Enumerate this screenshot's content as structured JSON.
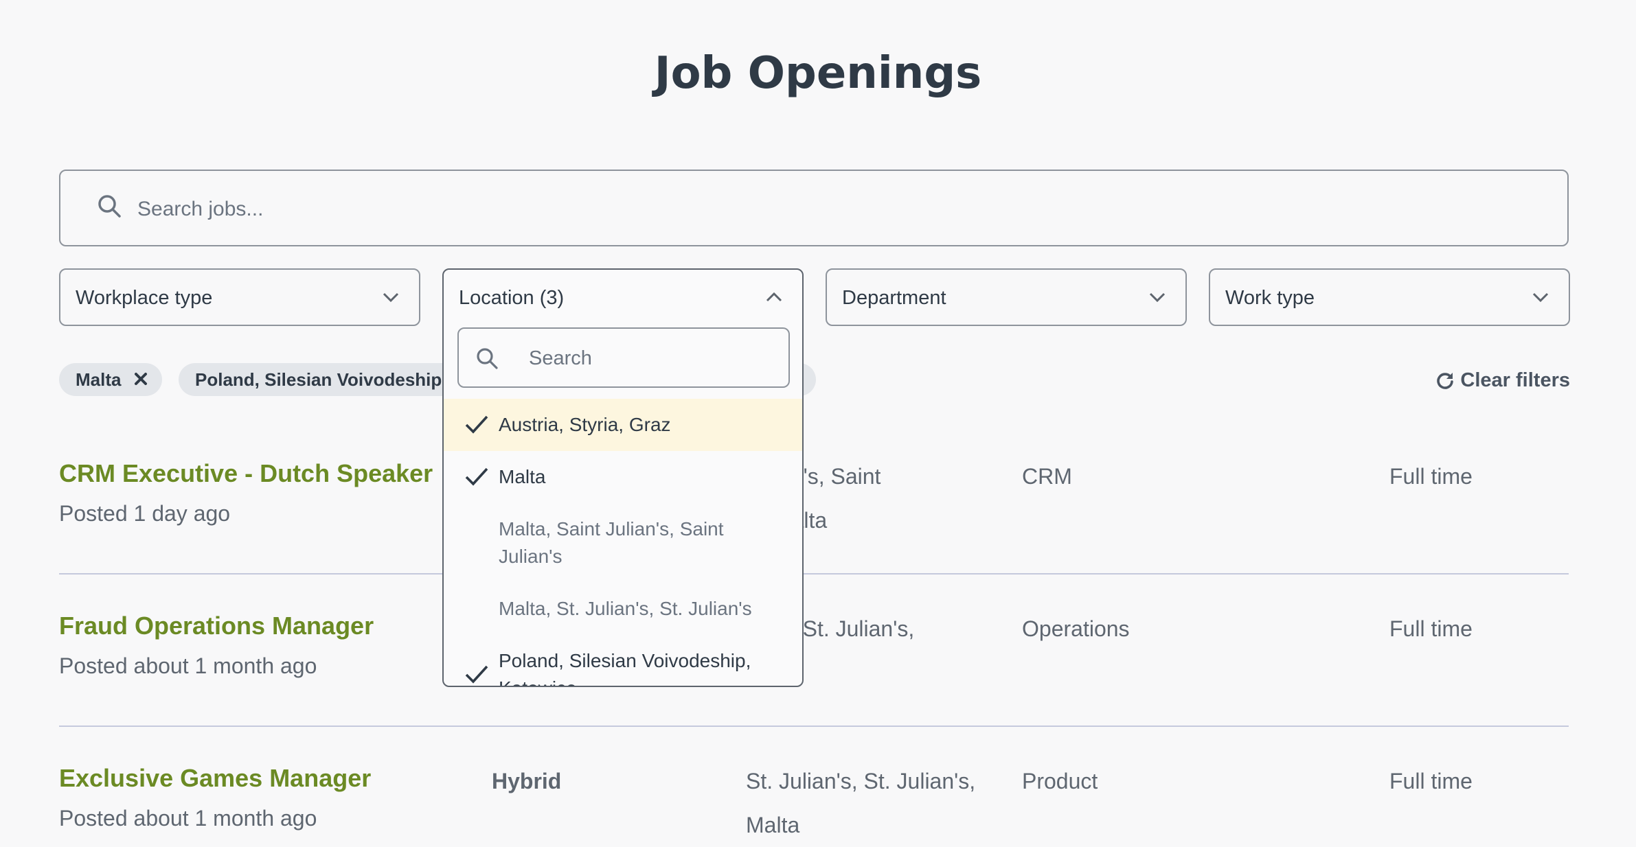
{
  "header": {
    "title": "Job Openings"
  },
  "search": {
    "placeholder": "Search jobs..."
  },
  "filters": {
    "workplace_type": {
      "label": "Workplace type"
    },
    "location": {
      "label": "Location (3)",
      "search_placeholder": "Search",
      "options": [
        {
          "label": "Austria, Styria, Graz",
          "selected": true,
          "highlighted": true
        },
        {
          "label": "Malta",
          "selected": true
        },
        {
          "label": "Malta, Saint Julian's, Saint Julian's",
          "selected": false
        },
        {
          "label": "Malta, St. Julian's, St. Julian's",
          "selected": false
        },
        {
          "label": "Poland, Silesian Voivodeship, Katowice",
          "selected": true
        }
      ]
    },
    "department": {
      "label": "Department"
    },
    "work_type": {
      "label": "Work type"
    }
  },
  "active_chips": [
    {
      "label": "Malta"
    },
    {
      "label": "Poland, Silesian Voivodeship, Katowice"
    }
  ],
  "clear_filters": {
    "label": "Clear filters"
  },
  "jobs": [
    {
      "title": "CRM Executive - Dutch Speaker",
      "posted": "Posted 1 day ago",
      "workplace": "",
      "location": "Julian's, Saint",
      "location_line2": "'s, Malta",
      "department": "CRM",
      "work_type": "Full time"
    },
    {
      "title": "Fraud Operations Manager",
      "posted": "Posted about 1 month ago",
      "workplace": "",
      "location": "ian's, St. Julian's,",
      "location_line2": "",
      "department": "Operations",
      "work_type": "Full time"
    },
    {
      "title": "Exclusive Games Manager",
      "posted": "Posted about 1 month ago",
      "workplace": "Hybrid",
      "location": "St. Julian's, St. Julian's,",
      "location_line2": "Malta",
      "department": "Product",
      "work_type": "Full time"
    }
  ],
  "colors": {
    "accent_green": "#6b8a24",
    "text_dark": "#2f3a46",
    "highlight": "#fdf6df",
    "chip_bg": "#e3e6ea"
  },
  "icons": [
    "search-icon",
    "chevron-down-icon",
    "chevron-up-icon",
    "check-icon",
    "close-icon",
    "refresh-icon"
  ]
}
